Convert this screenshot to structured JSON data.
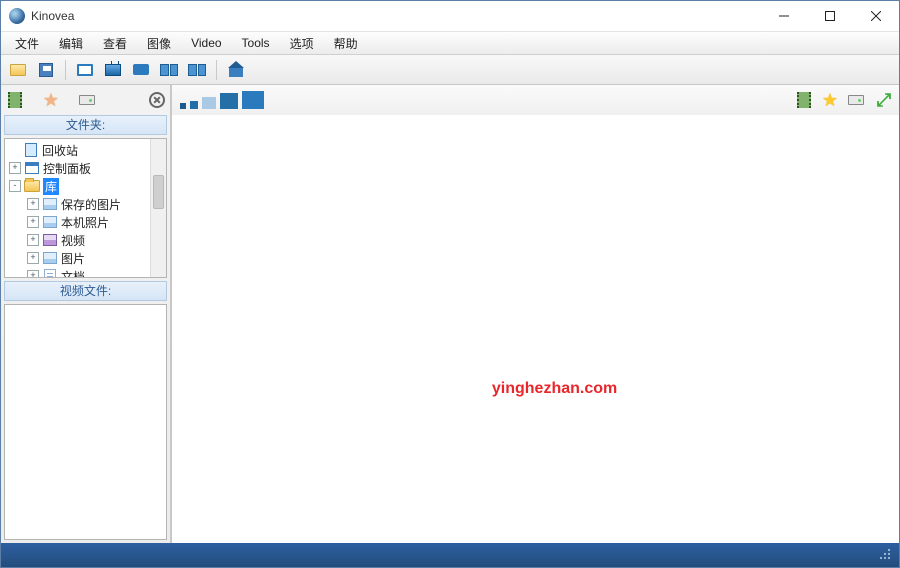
{
  "title": "Kinovea",
  "menu": [
    "文件",
    "编辑",
    "查看",
    "图像",
    "Video",
    "Tools",
    "选项",
    "帮助"
  ],
  "toolbar_icons": [
    "open",
    "save",
    "screen",
    "tv",
    "cam",
    "dual",
    "dual",
    "home"
  ],
  "left": {
    "tabs": [
      "film",
      "star",
      "drive"
    ],
    "folders_header": "文件夹:",
    "videos_header": "视频文件:",
    "tree": [
      {
        "indent": 0,
        "exp": "",
        "icon": "bin",
        "label": "回收站"
      },
      {
        "indent": 0,
        "exp": "+",
        "icon": "panel",
        "label": "控制面板"
      },
      {
        "indent": 0,
        "exp": "-",
        "icon": "folder",
        "label": "库",
        "selected": true
      },
      {
        "indent": 1,
        "exp": "+",
        "icon": "img",
        "label": "保存的图片"
      },
      {
        "indent": 1,
        "exp": "+",
        "icon": "img",
        "label": "本机照片"
      },
      {
        "indent": 1,
        "exp": "+",
        "icon": "vid",
        "label": "视频"
      },
      {
        "indent": 1,
        "exp": "+",
        "icon": "img",
        "label": "图片"
      },
      {
        "indent": 1,
        "exp": "+",
        "icon": "doc",
        "label": "文档"
      }
    ]
  },
  "right_icons": [
    "film",
    "star",
    "drive",
    "expand"
  ],
  "watermark": "yinghezhan.com"
}
